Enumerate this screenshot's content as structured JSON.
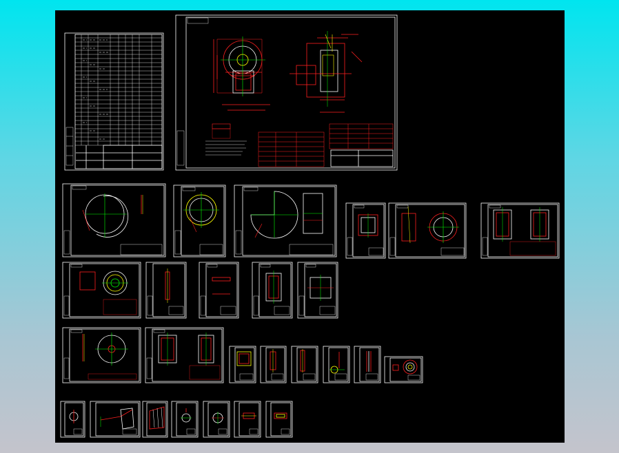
{
  "viewport": {
    "background": "#000000",
    "line_color": "#ffffff",
    "accent_colors": {
      "red": "#ff2020",
      "green": "#00ff00",
      "yellow": "#ffff00",
      "cyan": "#00e5ef"
    }
  },
  "sheets": [
    {
      "id": "bom-list",
      "kind": "table"
    },
    {
      "id": "assembly-drawing",
      "kind": "assembly"
    },
    {
      "id": "housing-plate-large",
      "kind": "circle-arc"
    },
    {
      "id": "ring-flange",
      "kind": "ring"
    },
    {
      "id": "volute-sector",
      "kind": "sector"
    },
    {
      "id": "side-plate-a",
      "kind": "part"
    },
    {
      "id": "hub-assembly",
      "kind": "ring-part"
    },
    {
      "id": "frame-part",
      "kind": "part"
    },
    {
      "id": "impeller-disk",
      "kind": "disk"
    },
    {
      "id": "shaft-strip",
      "kind": "strip"
    },
    {
      "id": "bar-part",
      "kind": "strip"
    },
    {
      "id": "bracket-part",
      "kind": "part"
    },
    {
      "id": "plate-part",
      "kind": "part"
    },
    {
      "id": "back-plate-disk",
      "kind": "disk"
    },
    {
      "id": "casing-part",
      "kind": "part"
    },
    {
      "id": "small-part-1",
      "kind": "small"
    },
    {
      "id": "small-part-2",
      "kind": "small"
    },
    {
      "id": "small-part-3",
      "kind": "small"
    },
    {
      "id": "small-part-4",
      "kind": "small"
    },
    {
      "id": "small-part-5",
      "kind": "small"
    },
    {
      "id": "small-part-6",
      "kind": "small"
    },
    {
      "id": "mini-sheet-1",
      "kind": "mini"
    },
    {
      "id": "mini-sheet-2",
      "kind": "mini"
    },
    {
      "id": "mini-sheet-3",
      "kind": "mini"
    },
    {
      "id": "mini-sheet-4",
      "kind": "mini"
    },
    {
      "id": "mini-sheet-5",
      "kind": "mini"
    },
    {
      "id": "mini-sheet-6",
      "kind": "mini"
    },
    {
      "id": "mini-sheet-7",
      "kind": "mini"
    }
  ]
}
